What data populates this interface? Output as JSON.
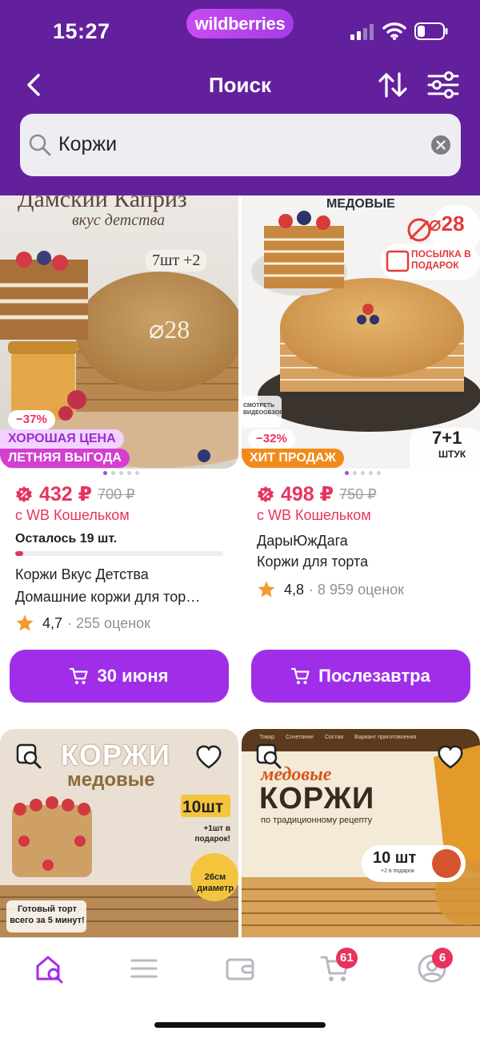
{
  "status_bar": {
    "time": "15:27",
    "brand": "wildberries"
  },
  "nav": {
    "title": "Поиск",
    "back_icon": "chevron-left-icon",
    "sort_icon": "sort-arrows-icon",
    "filter_icon": "filter-sliders-icon"
  },
  "search": {
    "query": "Коржи"
  },
  "colors": {
    "header": "#63209c",
    "accent": "#a02ee8",
    "price": "#e8335d",
    "star": "#f29a2e"
  },
  "products": [
    {
      "image_title": "Дамский Каприз",
      "image_subtitle": "вкус детства",
      "image_count": "7шт +2",
      "image_diameter": "⌀28",
      "discount": "−37%",
      "tags": [
        "ХОРОШАЯ ЦЕНА",
        "ЛЕТНЯЯ ВЫГОДА"
      ],
      "price": "432 ₽",
      "old_price": "700 ₽",
      "wallet": "с WB Кошельком",
      "stock_left": "Осталось 19 шт.",
      "stock_progress": 0.04,
      "title_line1": "Коржи Вкус Детства",
      "title_line2": "Домашние коржи для тор…",
      "rating": "4,7",
      "reviews": "· 255 оценок",
      "button": "30 июня"
    },
    {
      "image_title": "МЕДОВЫЕ",
      "image_diameter": "⌀28",
      "image_gift": "ПОСЫЛКА В ПОДАРОК",
      "image_count": "7+1",
      "image_count_unit": "ШТУК",
      "image_video": "СМОТРЕТЬ ВИДЕООБЗОР",
      "discount": "−32%",
      "tags": [
        "ХИТ ПРОДАЖ"
      ],
      "price": "498 ₽",
      "old_price": "750 ₽",
      "wallet": "с WB Кошельком",
      "brand": "ДарыЮжДага",
      "title_line1": "Коржи для торта",
      "rating": "4,8",
      "reviews": "· 8 959 оценок",
      "button": "Послезавтра"
    },
    {
      "image_title": "КОРЖИ",
      "image_subtitle": "медовые",
      "image_count": "10шт",
      "image_bonus": "+1шт в подарок!",
      "image_diameter": "26см диаметр",
      "image_note": "Готовый торт всего за 5 минут!"
    },
    {
      "image_header": [
        "Товар",
        "Сочетание",
        "Состав",
        "Вариант приготовления"
      ],
      "image_title_small": "медовые",
      "image_title": "КОРЖИ",
      "image_subtitle": "по традиционному рецепту",
      "image_count": "10 шт",
      "image_bonus": "+2 в подарок"
    }
  ],
  "tabbar": {
    "items": [
      "home-search-icon",
      "catalog-menu-icon",
      "wallet-icon",
      "cart-icon",
      "profile-icon"
    ],
    "cart_badge": "61",
    "profile_badge": "6"
  }
}
